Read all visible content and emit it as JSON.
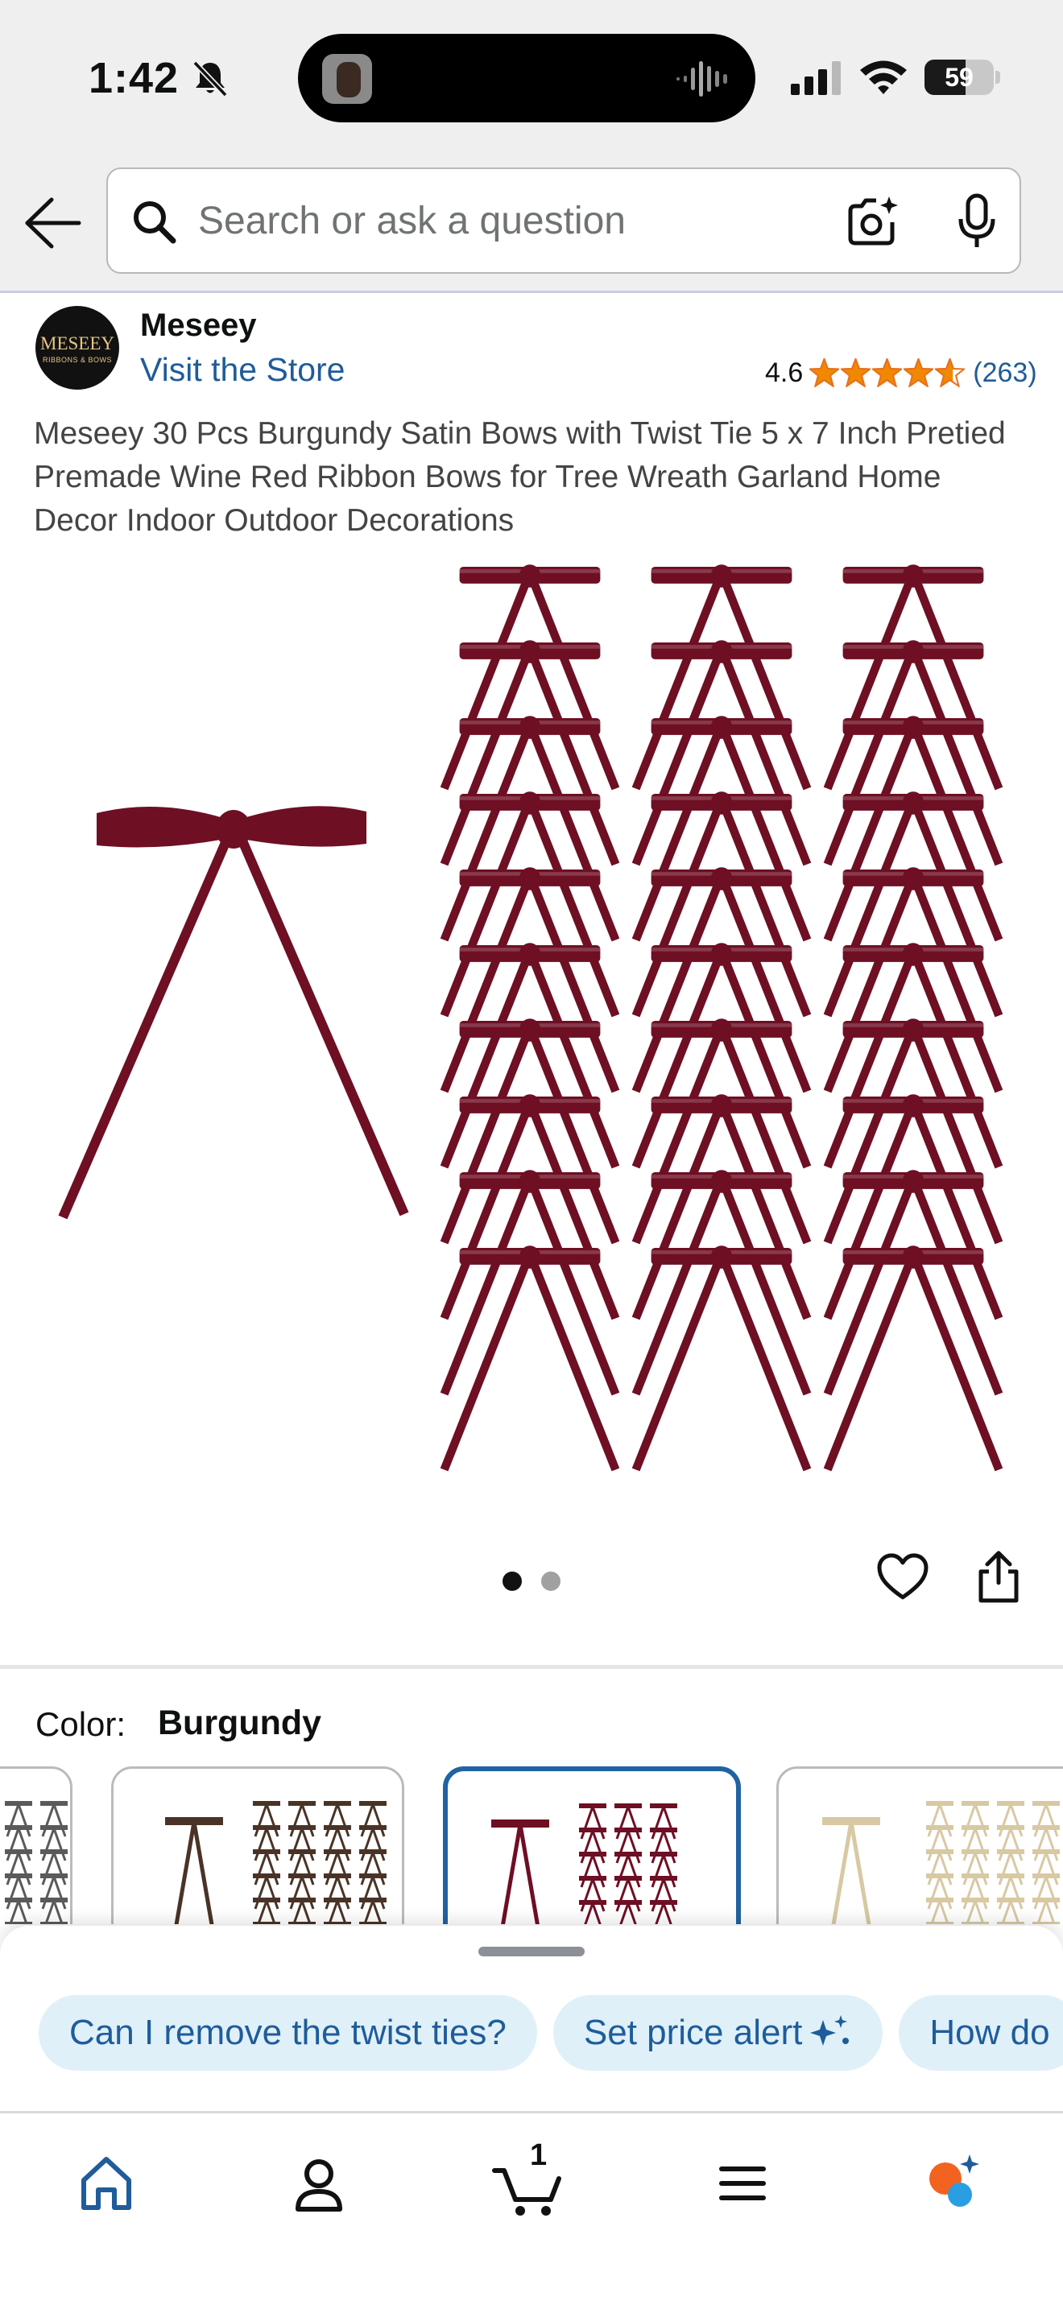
{
  "status_bar": {
    "time": "1:42",
    "battery_level": "59",
    "battery_fraction": 0.59
  },
  "search": {
    "placeholder": "Search or ask a question"
  },
  "product": {
    "brand": "Meseey",
    "brand_logo_text": "MESEEY",
    "brand_logo_subtext": "RIBBONS & BOWS",
    "visit_store": "Visit the Store",
    "rating": "4.6",
    "rating_value": 4.6,
    "review_count": "(263)",
    "title": "Meseey 30 Pcs Burgundy Satin Bows with Twist Tie 5 x 7 Inch Pretied Premade Wine Red Ribbon Bows for Tree Wreath Garland Home Decor Indoor Outdoor Decorations",
    "image_count": 2,
    "active_image": 1,
    "ribbon_color": "#6e0f24"
  },
  "color": {
    "label": "Color:",
    "selected": "Burgundy",
    "swatch_colors": [
      "#3a3a3a",
      "#4a3326",
      "#6e0f24",
      "#d8c9a3"
    ]
  },
  "assistant": {
    "chips": [
      {
        "label": "Can I remove the twist ties?",
        "sparkle": false
      },
      {
        "label": "Set price alert",
        "sparkle": true
      },
      {
        "label": "How do",
        "sparkle": false
      }
    ]
  },
  "nav": {
    "cart_count": "1",
    "accent_color": "#1f5c9a",
    "assistant_colors": [
      "#f2631f",
      "#2a9ee3"
    ]
  }
}
